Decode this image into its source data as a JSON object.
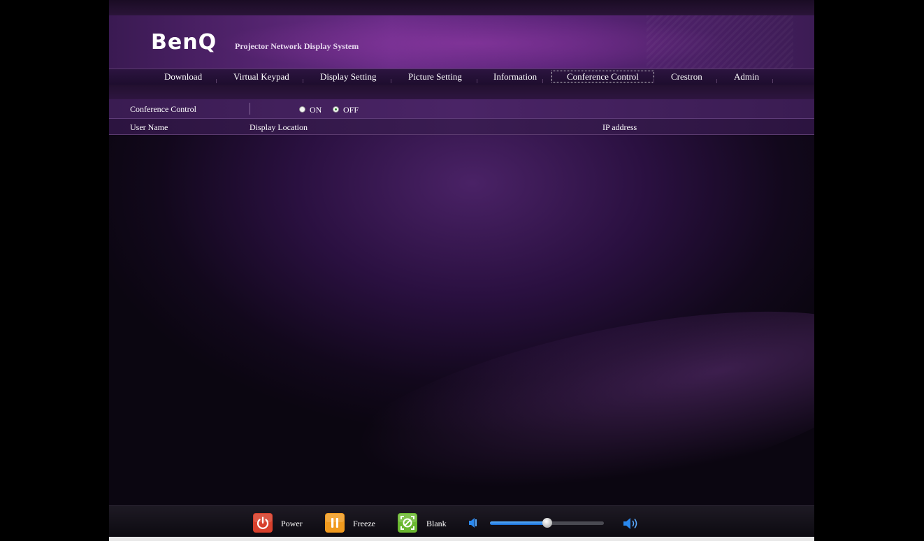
{
  "brand": {
    "logo_text": "BenQ",
    "subtitle": "Projector Network Display System"
  },
  "nav": {
    "items": [
      {
        "label": "Download"
      },
      {
        "label": "Virtual Keypad"
      },
      {
        "label": "Display Setting"
      },
      {
        "label": "Picture Setting"
      },
      {
        "label": "Information"
      },
      {
        "label": "Conference Control",
        "active": true
      },
      {
        "label": "Crestron"
      },
      {
        "label": "Admin"
      }
    ]
  },
  "conference": {
    "label": "Conference Control",
    "on_label": "ON",
    "off_label": "OFF",
    "selected": "OFF"
  },
  "table": {
    "columns": [
      "User Name",
      "Display Location",
      "IP address"
    ],
    "rows": []
  },
  "footer": {
    "power_label": "Power",
    "freeze_label": "Freeze",
    "blank_label": "Blank",
    "volume_level": 0.5
  },
  "colors": {
    "power": "#d8402c",
    "freeze": "#f09a1e",
    "blank": "#6ab830",
    "volume": "#2a88ee"
  },
  "icons": {
    "power": "power-icon",
    "freeze": "pause-icon",
    "blank": "blank-screen-icon",
    "volume_down": "speaker-low-icon",
    "volume_up": "speaker-high-icon"
  }
}
